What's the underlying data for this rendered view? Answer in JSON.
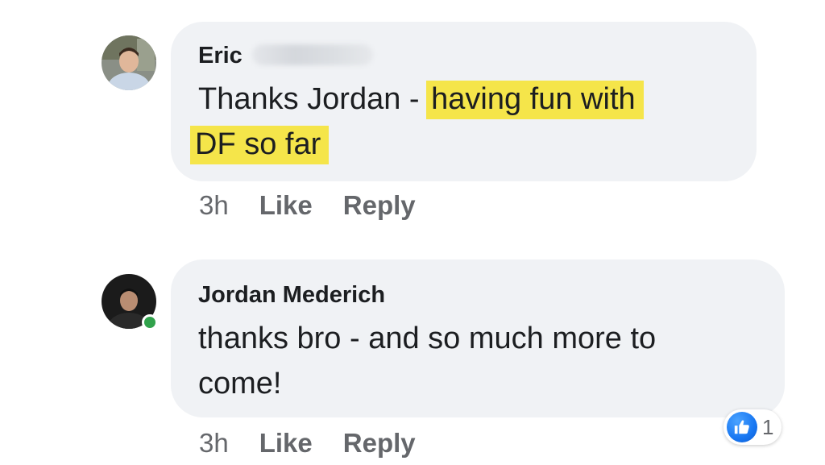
{
  "comments": [
    {
      "author": "Eric",
      "text_plain": "Thanks Jordan - ",
      "text_highlight_line1": "having fun with",
      "text_highlight_line2": "DF so far",
      "time": "3h",
      "like_label": "Like",
      "reply_label": "Reply",
      "avatar_icon": "person-avatar-icon",
      "surname_redacted": true
    },
    {
      "author": "Jordan Mederich",
      "text_line1": "thanks bro - and so much more to",
      "text_line2": "come!",
      "time": "3h",
      "like_label": "Like",
      "reply_label": "Reply",
      "online": true,
      "avatar_icon": "person-avatar-icon",
      "reaction": {
        "icon": "thumbs-up-icon",
        "count": "1"
      }
    }
  ],
  "colors": {
    "bubble": "#f0f2f5",
    "highlight": "#f5e54a",
    "online": "#31a24c",
    "like_blue": "#1877f2",
    "secondary_text": "#65676b"
  }
}
